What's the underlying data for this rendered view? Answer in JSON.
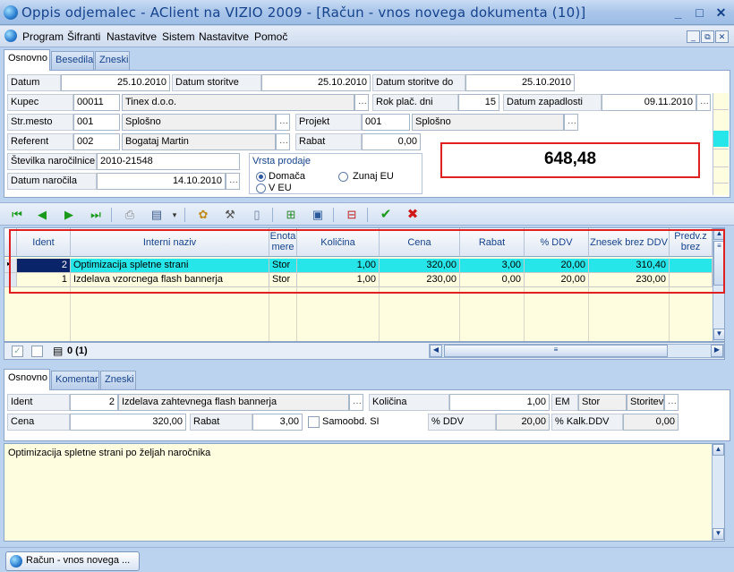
{
  "window": {
    "title": "Oppis odjemalec - AClient na VIZIO 2009 - [Račun - vnos novega dokumenta (10)]",
    "minimize": "_",
    "maximize": "□",
    "close": "✕"
  },
  "menu": {
    "items": [
      "Program",
      "Šifranti",
      "Nastavitve",
      "Sistem",
      "Nastavitve",
      "Pomoč"
    ],
    "mdi_buttons": [
      "_",
      "⧉",
      "✕"
    ]
  },
  "top_tabs": [
    "Osnovno",
    "Besedila",
    "Zneski"
  ],
  "header": {
    "datum_label": "Datum",
    "datum_value": "25.10.2010",
    "datum_storitve_label": "Datum storitve",
    "datum_storitve_value": "25.10.2010",
    "datum_storitve_do_label": "Datum storitve do",
    "datum_storitve_do_value": "25.10.2010",
    "kupec_label": "Kupec",
    "kupec_code": "00011",
    "kupec_name": "Tinex d.o.o.",
    "rok_label": "Rok plač. dni",
    "rok_value": "15",
    "datum_zapadlosti_label": "Datum zapadlosti",
    "datum_zapadlosti_value": "09.11.2010",
    "strmesto_label": "Str.mesto",
    "strmesto_code": "001",
    "strmesto_name": "Splošno",
    "projekt_label": "Projekt",
    "projekt_code": "001",
    "projekt_name": "Splošno",
    "referent_label": "Referent",
    "referent_code": "002",
    "referent_name": "Bogataj Martin",
    "rabat_label": "Rabat",
    "rabat_value": "0,00",
    "stevilka_label": "Številka naročilnice",
    "stevilka_value": "2010-21548",
    "datum_narocila_label": "Datum naročila",
    "datum_narocila_value": "14.10.2010",
    "vrsta_prodaje_label": "Vrsta prodaje",
    "vrsta_options": [
      "Domača",
      "Zunaj EU",
      "V EU"
    ],
    "vrsta_selected": "Domača",
    "total": "648,48",
    "ellipsis": "···"
  },
  "grid": {
    "columns": [
      "Ident",
      "Interni naziv",
      "Enota mere",
      "Količina",
      "Cena",
      "Rabat",
      "% DDV",
      "Znesek brez DDV",
      "Predv.z brez"
    ],
    "rows": [
      {
        "ident": "2",
        "naziv": "Optimizacija spletne strani",
        "em": "Stor",
        "kolicina": "1,00",
        "cena": "320,00",
        "rabat": "3,00",
        "ddv": "20,00",
        "znesek": "310,40",
        "selected": true
      },
      {
        "ident": "1",
        "naziv": "Izdelava vzorcnega flash bannerja",
        "em": "Stor",
        "kolicina": "1,00",
        "cena": "230,00",
        "rabat": "0,00",
        "ddv": "20,00",
        "znesek": "230,00",
        "selected": false
      }
    ],
    "record_count": "0 (1)"
  },
  "bottom_tabs": [
    "Osnovno",
    "Komentar",
    "Zneski"
  ],
  "detail": {
    "ident_label": "Ident",
    "ident_value": "2",
    "ident_name": "Izdelava zahtevnega flash bannerja",
    "kolicina_label": "Količina",
    "kolicina_value": "1,00",
    "em_label": "EM",
    "em_value": "Stor",
    "em_name": "Storitev",
    "cena_label": "Cena",
    "cena_value": "320,00",
    "rabat_label": "Rabat",
    "rabat_value": "3,00",
    "samoobd_label": "Samoobd. SI",
    "ddv_label": "% DDV",
    "ddv_value": "20,00",
    "kalk_label": "% Kalk.DDV",
    "kalk_value": "0,00",
    "memo": "Optimizacija spletne strani po željah naročnika"
  },
  "taskbar": {
    "button": "Račun - vnos novega ..."
  },
  "colors": {
    "accent": "#15428b",
    "selected_row": "#27e6ea",
    "highlight_border": "#e02020"
  }
}
